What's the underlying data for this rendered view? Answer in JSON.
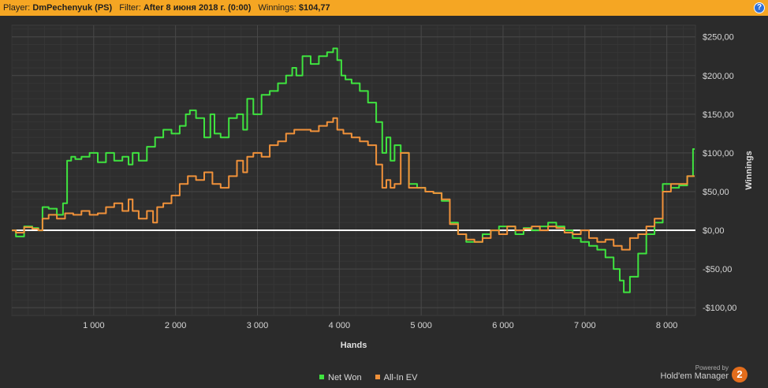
{
  "header": {
    "player_label": "Player:",
    "player_value": "DmPechenyuk (PS)",
    "filter_label": "Filter:",
    "filter_value": "After 8 июня 2018 г. (0:00)",
    "winnings_label": "Winnings:",
    "winnings_value": "$104,77",
    "help_glyph": "?"
  },
  "brand": {
    "powered_by": "Powered by",
    "name": "Hold'em Manager",
    "logo_glyph": "2"
  },
  "colors": {
    "net_won": "#3fe33f",
    "allin_ev": "#f0913a",
    "zero_line": "#ffffff",
    "background": "#2b2b2b",
    "header": "#f5a623"
  },
  "chart_data": {
    "type": "line",
    "xlabel": "Hands",
    "ylabel": "Winnings",
    "xlim": [
      0,
      8350
    ],
    "ylim": [
      -110,
      265
    ],
    "x_ticks": [
      1000,
      2000,
      3000,
      4000,
      5000,
      6000,
      7000,
      8000
    ],
    "x_tick_labels": [
      "1 000",
      "2 000",
      "3 000",
      "4 000",
      "5 000",
      "6 000",
      "7 000",
      "8 000"
    ],
    "y_ticks": [
      -100,
      -50,
      0,
      50,
      100,
      150,
      200,
      250
    ],
    "y_tick_labels": [
      "-$100,00",
      "-$50,00",
      "$0,00",
      "$50,00",
      "$100,00",
      "$150,00",
      "$200,00",
      "$250,00"
    ],
    "grid": true,
    "legend_position": "bottom-center",
    "series": [
      {
        "name": "Net Won",
        "color": "#3fe33f",
        "x": [
          0,
          100,
          200,
          300,
          350,
          400,
          500,
          600,
          650,
          700,
          750,
          800,
          900,
          1000,
          1100,
          1200,
          1300,
          1400,
          1450,
          1500,
          1600,
          1700,
          1800,
          1900,
          2000,
          2100,
          2150,
          2200,
          2300,
          2400,
          2450,
          2500,
          2600,
          2700,
          2800,
          2850,
          2900,
          3000,
          3100,
          3200,
          3300,
          3400,
          3450,
          3500,
          3600,
          3700,
          3800,
          3900,
          3950,
          4000,
          4050,
          4100,
          4200,
          4300,
          4400,
          4500,
          4550,
          4600,
          4650,
          4700,
          4800,
          4900,
          5000,
          5100,
          5200,
          5300,
          5400,
          5500,
          5600,
          5700,
          5800,
          5900,
          6000,
          6100,
          6200,
          6300,
          6400,
          6500,
          6600,
          6700,
          6800,
          6900,
          7000,
          7100,
          7200,
          7300,
          7400,
          7450,
          7500,
          7600,
          7700,
          7800,
          7900,
          8000,
          8100,
          8200,
          8300,
          8340
        ],
        "values": [
          0,
          -8,
          5,
          3,
          0,
          30,
          28,
          20,
          35,
          90,
          95,
          92,
          95,
          100,
          88,
          100,
          90,
          95,
          85,
          100,
          90,
          108,
          120,
          130,
          125,
          135,
          150,
          155,
          145,
          120,
          150,
          125,
          120,
          145,
          150,
          130,
          170,
          150,
          175,
          180,
          190,
          200,
          210,
          200,
          225,
          215,
          225,
          230,
          235,
          220,
          200,
          195,
          190,
          180,
          165,
          140,
          100,
          120,
          90,
          110,
          100,
          60,
          55,
          50,
          48,
          38,
          10,
          -5,
          -15,
          -15,
          -5,
          0,
          5,
          5,
          -5,
          3,
          0,
          5,
          10,
          5,
          0,
          -10,
          -15,
          -20,
          -25,
          -35,
          -50,
          -65,
          -80,
          -60,
          -30,
          -5,
          10,
          60,
          55,
          58,
          70,
          105
        ]
      },
      {
        "name": "All-In EV",
        "color": "#f0913a",
        "x": [
          0,
          100,
          200,
          300,
          350,
          400,
          500,
          600,
          700,
          800,
          900,
          1000,
          1100,
          1200,
          1300,
          1400,
          1450,
          1500,
          1600,
          1700,
          1750,
          1800,
          1900,
          2000,
          2100,
          2200,
          2300,
          2400,
          2500,
          2600,
          2700,
          2800,
          2850,
          2900,
          3000,
          3100,
          3200,
          3300,
          3400,
          3500,
          3600,
          3700,
          3800,
          3900,
          3950,
          4000,
          4100,
          4200,
          4300,
          4400,
          4500,
          4550,
          4600,
          4650,
          4700,
          4800,
          4900,
          5000,
          5100,
          5200,
          5300,
          5400,
          5500,
          5600,
          5700,
          5800,
          5900,
          6000,
          6100,
          6200,
          6300,
          6400,
          6500,
          6600,
          6700,
          6800,
          6900,
          7000,
          7100,
          7200,
          7300,
          7400,
          7500,
          7600,
          7700,
          7800,
          7900,
          8000,
          8100,
          8200,
          8300,
          8340
        ],
        "values": [
          0,
          -3,
          4,
          2,
          0,
          15,
          20,
          15,
          22,
          20,
          25,
          20,
          22,
          30,
          35,
          25,
          40,
          25,
          15,
          25,
          10,
          30,
          35,
          45,
          60,
          70,
          65,
          75,
          60,
          55,
          70,
          90,
          75,
          95,
          100,
          95,
          110,
          115,
          125,
          130,
          130,
          128,
          135,
          140,
          145,
          130,
          125,
          120,
          115,
          110,
          85,
          55,
          65,
          55,
          60,
          100,
          55,
          55,
          50,
          48,
          40,
          8,
          -5,
          -12,
          -15,
          -10,
          0,
          -5,
          5,
          0,
          2,
          5,
          0,
          5,
          3,
          -3,
          -5,
          0,
          -10,
          -15,
          -12,
          -20,
          -25,
          -10,
          -5,
          5,
          15,
          50,
          60,
          60,
          70,
          70
        ]
      }
    ]
  }
}
